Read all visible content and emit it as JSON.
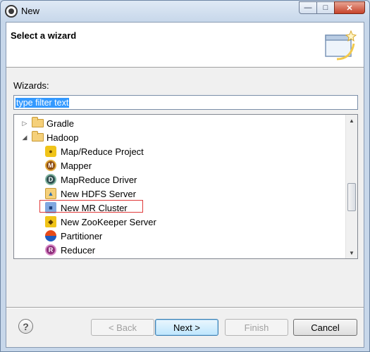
{
  "window": {
    "title": "New",
    "controls": [
      "minimize-icon",
      "maximize-icon",
      "close-icon"
    ]
  },
  "header": {
    "title": "Select a wizard",
    "banner_icon": "wizard-banner-icon"
  },
  "wizards": {
    "label": "Wizards:"
  },
  "filter": {
    "value": "type filter text",
    "selected": true
  },
  "tree": {
    "items": [
      {
        "label": "Gradle",
        "level": 0,
        "expanded": false,
        "icon": "folder-icon"
      },
      {
        "label": "Hadoop",
        "level": 0,
        "expanded": true,
        "icon": "folder-icon"
      },
      {
        "label": "Map/Reduce Project",
        "level": 1,
        "icon": "hadoop-elephant-icon"
      },
      {
        "label": "Mapper",
        "level": 1,
        "icon": "mapper-icon",
        "glyph": "M"
      },
      {
        "label": "MapReduce Driver",
        "level": 1,
        "icon": "driver-icon",
        "glyph": "D"
      },
      {
        "label": "New HDFS Server",
        "level": 1,
        "icon": "hdfs-server-icon"
      },
      {
        "label": "New MR Cluster",
        "level": 1,
        "icon": "mr-cluster-icon",
        "highlighted": true
      },
      {
        "label": "New ZooKeeper Server",
        "level": 1,
        "icon": "zookeeper-icon"
      },
      {
        "label": "Partitioner",
        "level": 1,
        "icon": "partitioner-icon"
      },
      {
        "label": "Reducer",
        "level": 1,
        "icon": "reducer-icon",
        "glyph": "R"
      }
    ]
  },
  "buttons": {
    "back": "< Back",
    "next": "Next >",
    "finish": "Finish",
    "cancel": "Cancel",
    "help": "?"
  },
  "colors": {
    "selection": "#3399ff",
    "highlight_border": "#e03a3a",
    "default_button": "#3c7fb1"
  }
}
